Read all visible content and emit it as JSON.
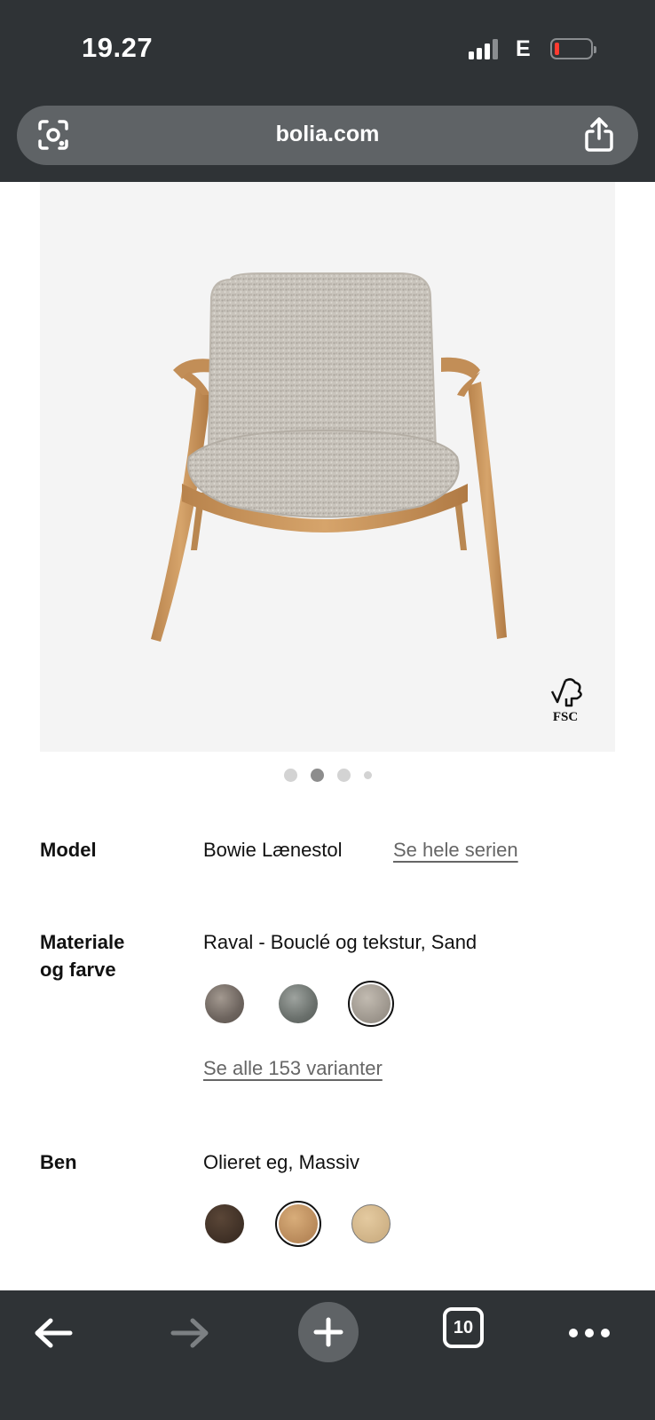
{
  "status_bar": {
    "time": "19.27",
    "network": "E",
    "battery_level": 0.1
  },
  "address_bar": {
    "domain": "bolia.com",
    "left_icon": "lens-icon",
    "right_icon": "share-icon"
  },
  "gallery": {
    "image_alt": "Bowie armchair",
    "badge": "FSC",
    "page_count": 4,
    "active_page": 2
  },
  "specs": {
    "model": {
      "label": "Model",
      "value": "Bowie Lænestol",
      "link": "Se hele serien"
    },
    "material": {
      "label_line1": "Materiale",
      "label_line2": "og farve",
      "value": "Raval - Bouclé og tekstur, Sand",
      "swatches": [
        "#7d746e",
        "#6e736f",
        "#a59e94"
      ],
      "selected_index": 2,
      "link": "Se alle 153 varianter"
    },
    "legs": {
      "label": "Ben",
      "value": "Olieret eg, Massiv",
      "swatches": [
        "#4a3a2e",
        "#c39a6b",
        "#d8bf97"
      ],
      "selected_index": 1
    }
  },
  "toolbar": {
    "back_icon": "back-arrow-icon",
    "forward_icon": "forward-arrow-icon",
    "new_tab_icon": "plus-icon",
    "tab_count": "10",
    "more_icon": "more-icon"
  },
  "colors": {
    "chrome": "#2f3336",
    "address_pill": "#5f6366",
    "image_bg": "#f4f4f4",
    "link": "#666666"
  }
}
